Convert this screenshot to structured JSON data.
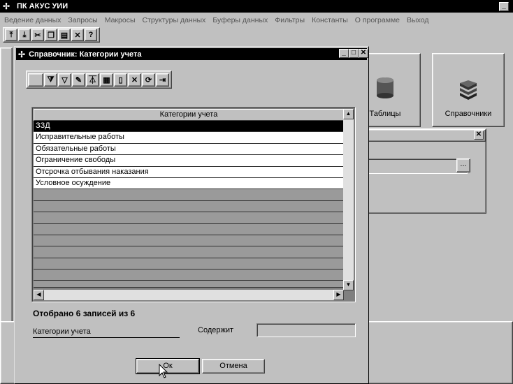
{
  "app": {
    "title": "ПК АКУС УИИ"
  },
  "menu": [
    "Ведение данных",
    "Запросы",
    "Макросы",
    "Структуры данных",
    "Буферы данных",
    "Фильтры",
    "Константы",
    "О программе",
    "Выход"
  ],
  "main_toolbar": {
    "icons": [
      "first-record-icon",
      "last-record-icon",
      "cut-icon",
      "copy-icon",
      "paste-icon",
      "delete-icon",
      "help-icon"
    ]
  },
  "workspace": {
    "tables_label": "Таблицы",
    "reference_label": "Справочники",
    "browse_label": "..."
  },
  "dialog": {
    "title": "Справочник: Категории учета",
    "toolbar_icons": [
      "blank-icon",
      "filter-apply-icon",
      "filter-icon",
      "filter-edit-icon",
      "filter-clear-icon",
      "filter-save-icon",
      "new-document-icon",
      "delete-icon",
      "refresh-icon",
      "exit-icon"
    ],
    "grid": {
      "header": "Категории учета",
      "rows": [
        "ЗЗД",
        "Исправительные работы",
        "Обязательные работы",
        "Ограничение свободы",
        "Отсрочка отбывания наказания",
        "Условное осуждение"
      ],
      "selected_index": 0,
      "empty_rows": 9
    },
    "count_text": "Отобрано 6 записей из 6",
    "filter_field_label": "Категории учета",
    "contains_label": "Содержит",
    "contains_value": "",
    "ok_label": "Ок",
    "cancel_label": "Отмена"
  }
}
